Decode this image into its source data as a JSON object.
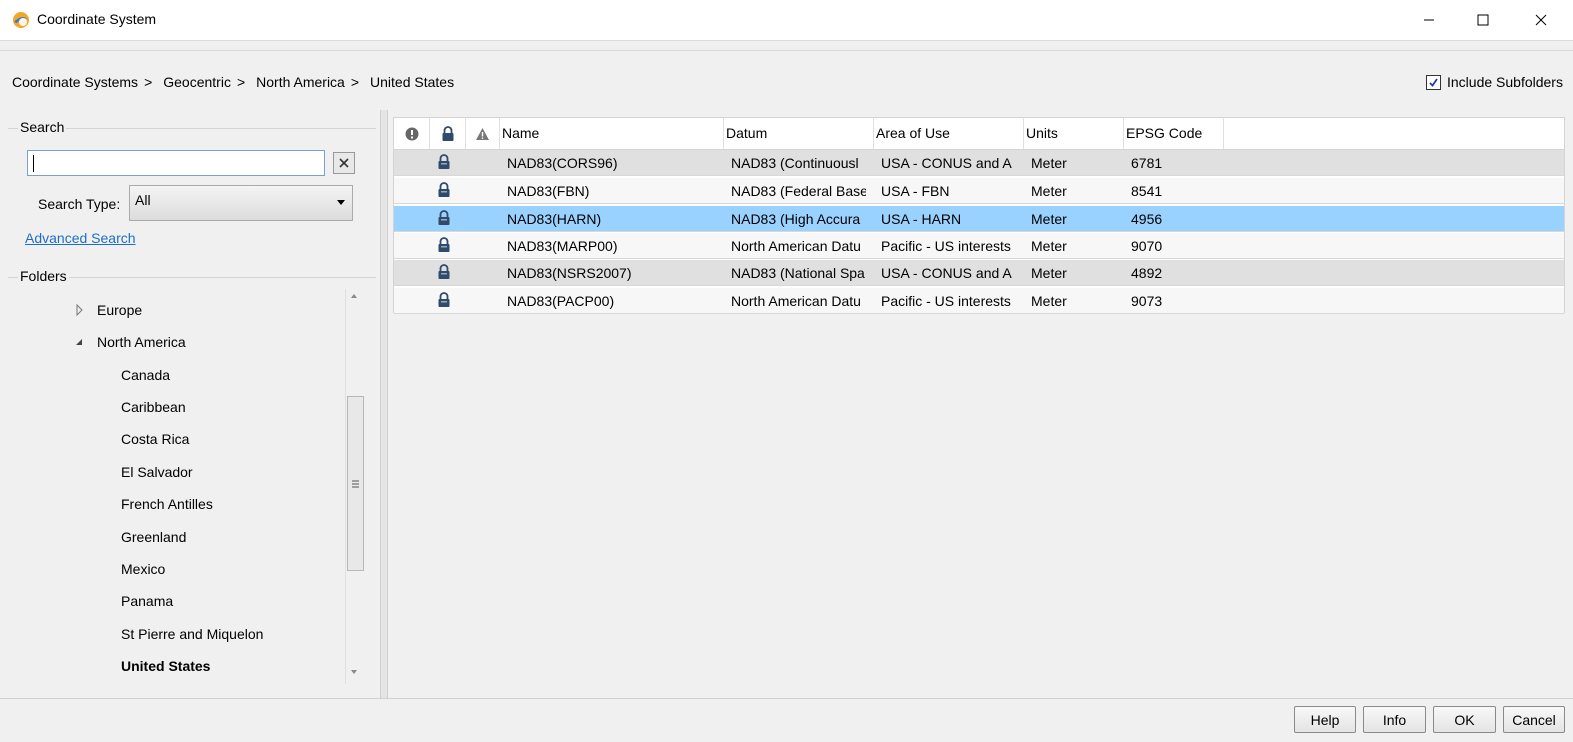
{
  "window": {
    "title": "Coordinate System",
    "minimize_icon": "minimize-icon",
    "maximize_icon": "maximize-icon",
    "close_icon": "close-icon"
  },
  "breadcrumb": {
    "items": [
      "Coordinate Systems",
      "Geocentric",
      "North America",
      "United States"
    ],
    "separator": ">"
  },
  "include_subfolders": {
    "label": "Include Subfolders",
    "checked": true
  },
  "search": {
    "group_label": "Search",
    "input_value": "",
    "type_label": "Search Type:",
    "type_value": "All",
    "advanced_link": "Advanced Search"
  },
  "folders": {
    "group_label": "Folders",
    "items": [
      {
        "label": "Europe",
        "expanded": false,
        "level": 1
      },
      {
        "label": "North America",
        "expanded": true,
        "level": 1
      },
      {
        "label": "Canada",
        "level": 2
      },
      {
        "label": "Caribbean",
        "level": 2
      },
      {
        "label": "Costa Rica",
        "level": 2
      },
      {
        "label": "El Salvador",
        "level": 2
      },
      {
        "label": "French Antilles",
        "level": 2
      },
      {
        "label": "Greenland",
        "level": 2
      },
      {
        "label": "Mexico",
        "level": 2
      },
      {
        "label": "Panama",
        "level": 2
      },
      {
        "label": "St Pierre and Miquelon",
        "level": 2
      },
      {
        "label": "United States",
        "level": 2,
        "selected": true
      }
    ]
  },
  "grid": {
    "icon_columns": [
      "info-icon",
      "lock-icon",
      "warning-icon"
    ],
    "columns": [
      "Name",
      "Datum",
      "Area of Use",
      "Units",
      "EPSG Code"
    ],
    "rows": [
      {
        "name": "NAD83(CORS96)",
        "datum": "NAD83 (Continuousl",
        "area": "USA - CONUS and A",
        "units": "Meter",
        "epsg": "6781"
      },
      {
        "name": "NAD83(FBN)",
        "datum": "NAD83 (Federal Base",
        "area": "USA - FBN",
        "units": "Meter",
        "epsg": "8541"
      },
      {
        "name": "NAD83(HARN)",
        "datum": "NAD83 (High Accura",
        "area": "USA - HARN",
        "units": "Meter",
        "epsg": "4956",
        "selected": true
      },
      {
        "name": "NAD83(MARP00)",
        "datum": "North American Datu",
        "area": "Pacific - US interests",
        "units": "Meter",
        "epsg": "9070"
      },
      {
        "name": "NAD83(NSRS2007)",
        "datum": "NAD83 (National Spa",
        "area": "USA - CONUS and A",
        "units": "Meter",
        "epsg": "4892"
      },
      {
        "name": "NAD83(PACP00)",
        "datum": "North American Datu",
        "area": "Pacific - US interests",
        "units": "Meter",
        "epsg": "9073"
      }
    ]
  },
  "buttons": {
    "help": "Help",
    "info": "Info",
    "ok": "OK",
    "cancel": "Cancel"
  },
  "colors": {
    "selection": "#99d1ff",
    "link": "#1e6ec8",
    "accent": "#f5a623"
  }
}
